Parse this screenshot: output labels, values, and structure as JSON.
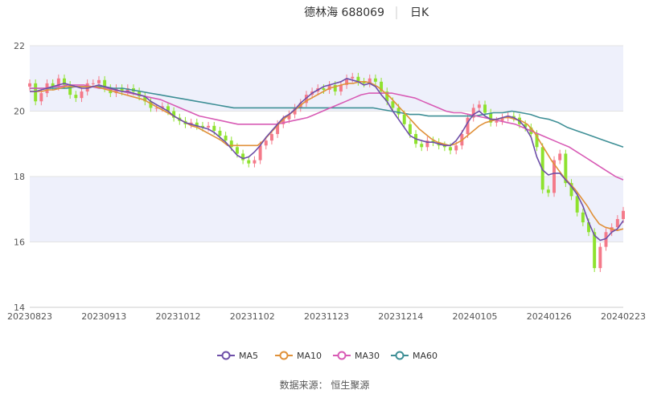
{
  "header": {
    "stock_label": "德林海 688069",
    "period_label": "日K"
  },
  "source_label": "数据来源： 恒生聚源",
  "chart_data": {
    "type": "candlestick",
    "y_ticks": [
      "22",
      "20",
      "18",
      "16",
      "14"
    ],
    "ylim": [
      14,
      22
    ],
    "x_tick_labels": [
      "20230823",
      "20230913",
      "20231012",
      "20231102",
      "20231123",
      "20231214",
      "20240105",
      "20240126",
      "20240223"
    ],
    "grid": true,
    "legend_position": "bottom",
    "colors": {
      "up": "#f47a8a",
      "down": "#8ee22e",
      "band": "#eef0fb",
      "MA5": "#6e4fa8",
      "MA10": "#e0913a",
      "MA30": "#d85bb5",
      "MA60": "#3e8f96"
    },
    "legend": [
      {
        "key": "MA5",
        "label": "MA5"
      },
      {
        "key": "MA10",
        "label": "MA10"
      },
      {
        "key": "MA30",
        "label": "MA30"
      },
      {
        "key": "MA60",
        "label": "MA60"
      }
    ],
    "close": [
      20.85,
      20.3,
      20.55,
      20.85,
      20.75,
      21.0,
      20.8,
      20.5,
      20.4,
      20.6,
      20.85,
      20.85,
      20.95,
      20.7,
      20.55,
      20.7,
      20.6,
      20.7,
      20.6,
      20.45,
      20.3,
      20.1,
      20.1,
      20.15,
      20.0,
      19.8,
      19.7,
      19.6,
      19.65,
      19.55,
      19.5,
      19.55,
      19.4,
      19.25,
      19.1,
      18.9,
      18.7,
      18.5,
      18.4,
      18.5,
      18.95,
      19.1,
      19.3,
      19.6,
      19.75,
      19.9,
      20.1,
      20.25,
      20.5,
      20.6,
      20.7,
      20.65,
      20.8,
      20.6,
      20.8,
      21.0,
      21.05,
      20.9,
      20.85,
      21.0,
      20.9,
      20.6,
      20.3,
      20.1,
      19.9,
      19.6,
      19.3,
      19.0,
      18.9,
      19.1,
      19.05,
      18.95,
      18.9,
      18.8,
      18.95,
      19.3,
      19.8,
      20.1,
      20.2,
      19.95,
      19.65,
      19.7,
      19.8,
      19.85,
      19.8,
      19.6,
      19.5,
      19.3,
      18.9,
      17.6,
      17.5,
      18.5,
      18.7,
      17.8,
      17.4,
      16.9,
      16.6,
      16.3,
      15.2,
      15.85,
      16.3,
      16.45,
      16.7,
      16.95
    ],
    "ma5": [
      20.6,
      20.6,
      20.65,
      20.7,
      20.75,
      20.8,
      20.85,
      20.8,
      20.75,
      20.7,
      20.7,
      20.75,
      20.8,
      20.75,
      20.7,
      20.65,
      20.6,
      20.6,
      20.55,
      20.5,
      20.45,
      20.3,
      20.2,
      20.1,
      20.0,
      19.85,
      19.75,
      19.65,
      19.6,
      19.55,
      19.5,
      19.45,
      19.35,
      19.2,
      19.05,
      18.85,
      18.65,
      18.55,
      18.6,
      18.75,
      18.95,
      19.2,
      19.4,
      19.6,
      19.8,
      19.9,
      20.05,
      20.25,
      20.4,
      20.55,
      20.65,
      20.75,
      20.8,
      20.85,
      20.9,
      21.0,
      20.95,
      20.9,
      20.8,
      20.85,
      20.75,
      20.5,
      20.3,
      20.0,
      19.75,
      19.5,
      19.25,
      19.15,
      19.1,
      19.05,
      19.05,
      19.0,
      18.95,
      18.95,
      19.1,
      19.35,
      19.65,
      19.9,
      20.0,
      19.85,
      19.75,
      19.75,
      19.8,
      19.85,
      19.8,
      19.7,
      19.5,
      19.2,
      18.6,
      18.2,
      18.05,
      18.1,
      18.1,
      17.9,
      17.7,
      17.45,
      17.1,
      16.6,
      16.2,
      16.05,
      16.1,
      16.3,
      16.4,
      16.65
    ],
    "ma10": [
      20.6,
      20.6,
      20.6,
      20.65,
      20.65,
      20.7,
      20.75,
      20.75,
      20.75,
      20.75,
      20.75,
      20.75,
      20.7,
      20.65,
      20.6,
      20.55,
      20.5,
      20.45,
      20.4,
      20.35,
      20.25,
      20.15,
      20.05,
      19.95,
      19.85,
      19.75,
      19.65,
      19.55,
      19.5,
      19.4,
      19.3,
      19.2,
      19.1,
      18.95,
      18.95,
      18.95,
      18.95,
      18.95,
      18.95,
      19.1,
      19.3,
      19.5,
      19.7,
      19.85,
      20.0,
      20.15,
      20.3,
      20.4,
      20.5,
      20.6,
      20.7,
      20.75,
      20.8,
      20.85,
      20.85,
      20.9,
      20.9,
      20.85,
      20.75,
      20.6,
      20.45,
      20.25,
      20.05,
      19.85,
      19.65,
      19.45,
      19.3,
      19.15,
      19.05,
      19.0,
      18.95,
      19.0,
      19.1,
      19.25,
      19.4,
      19.55,
      19.65,
      19.7,
      19.75,
      19.8,
      19.8,
      19.75,
      19.7,
      19.6,
      19.4,
      19.1,
      18.8,
      18.5,
      18.25,
      18.0,
      17.8,
      17.6,
      17.35,
      17.1,
      16.8,
      16.55,
      16.45,
      16.4,
      16.35,
      16.4
    ],
    "ma30": [
      20.7,
      20.7,
      20.7,
      20.75,
      20.75,
      20.8,
      20.8,
      20.8,
      20.75,
      20.7,
      20.7,
      20.65,
      20.6,
      20.55,
      20.5,
      20.45,
      20.4,
      20.35,
      20.25,
      20.15,
      20.05,
      19.95,
      19.85,
      19.8,
      19.75,
      19.7,
      19.65,
      19.6,
      19.6,
      19.6,
      19.6,
      19.6,
      19.6,
      19.65,
      19.7,
      19.75,
      19.8,
      19.9,
      20.0,
      20.1,
      20.2,
      20.3,
      20.4,
      20.5,
      20.55,
      20.55,
      20.55,
      20.55,
      20.5,
      20.45,
      20.4,
      20.3,
      20.2,
      20.1,
      20.0,
      19.95,
      19.95,
      19.9,
      19.85,
      19.8,
      19.75,
      19.7,
      19.65,
      19.6,
      19.5,
      19.4,
      19.3,
      19.2,
      19.1,
      19.0,
      18.9,
      18.75,
      18.6,
      18.45,
      18.3,
      18.15,
      18.0,
      17.9
    ],
    "ma60": [
      20.7,
      20.7,
      20.7,
      20.7,
      20.7,
      20.75,
      20.75,
      20.75,
      20.75,
      20.7,
      20.7,
      20.65,
      20.6,
      20.55,
      20.5,
      20.45,
      20.4,
      20.35,
      20.3,
      20.25,
      20.2,
      20.15,
      20.1,
      20.1,
      20.1,
      20.1,
      20.1,
      20.1,
      20.1,
      20.1,
      20.1,
      20.1,
      20.1,
      20.1,
      20.1,
      20.1,
      20.1,
      20.1,
      20.05,
      20.0,
      19.95,
      19.9,
      19.9,
      19.85,
      19.85,
      19.85,
      19.85,
      19.85,
      19.85,
      19.9,
      19.95,
      19.95,
      20.0,
      19.95,
      19.9,
      19.8,
      19.75,
      19.65,
      19.5,
      19.4,
      19.3,
      19.2,
      19.1,
      19.0,
      18.9
    ]
  }
}
